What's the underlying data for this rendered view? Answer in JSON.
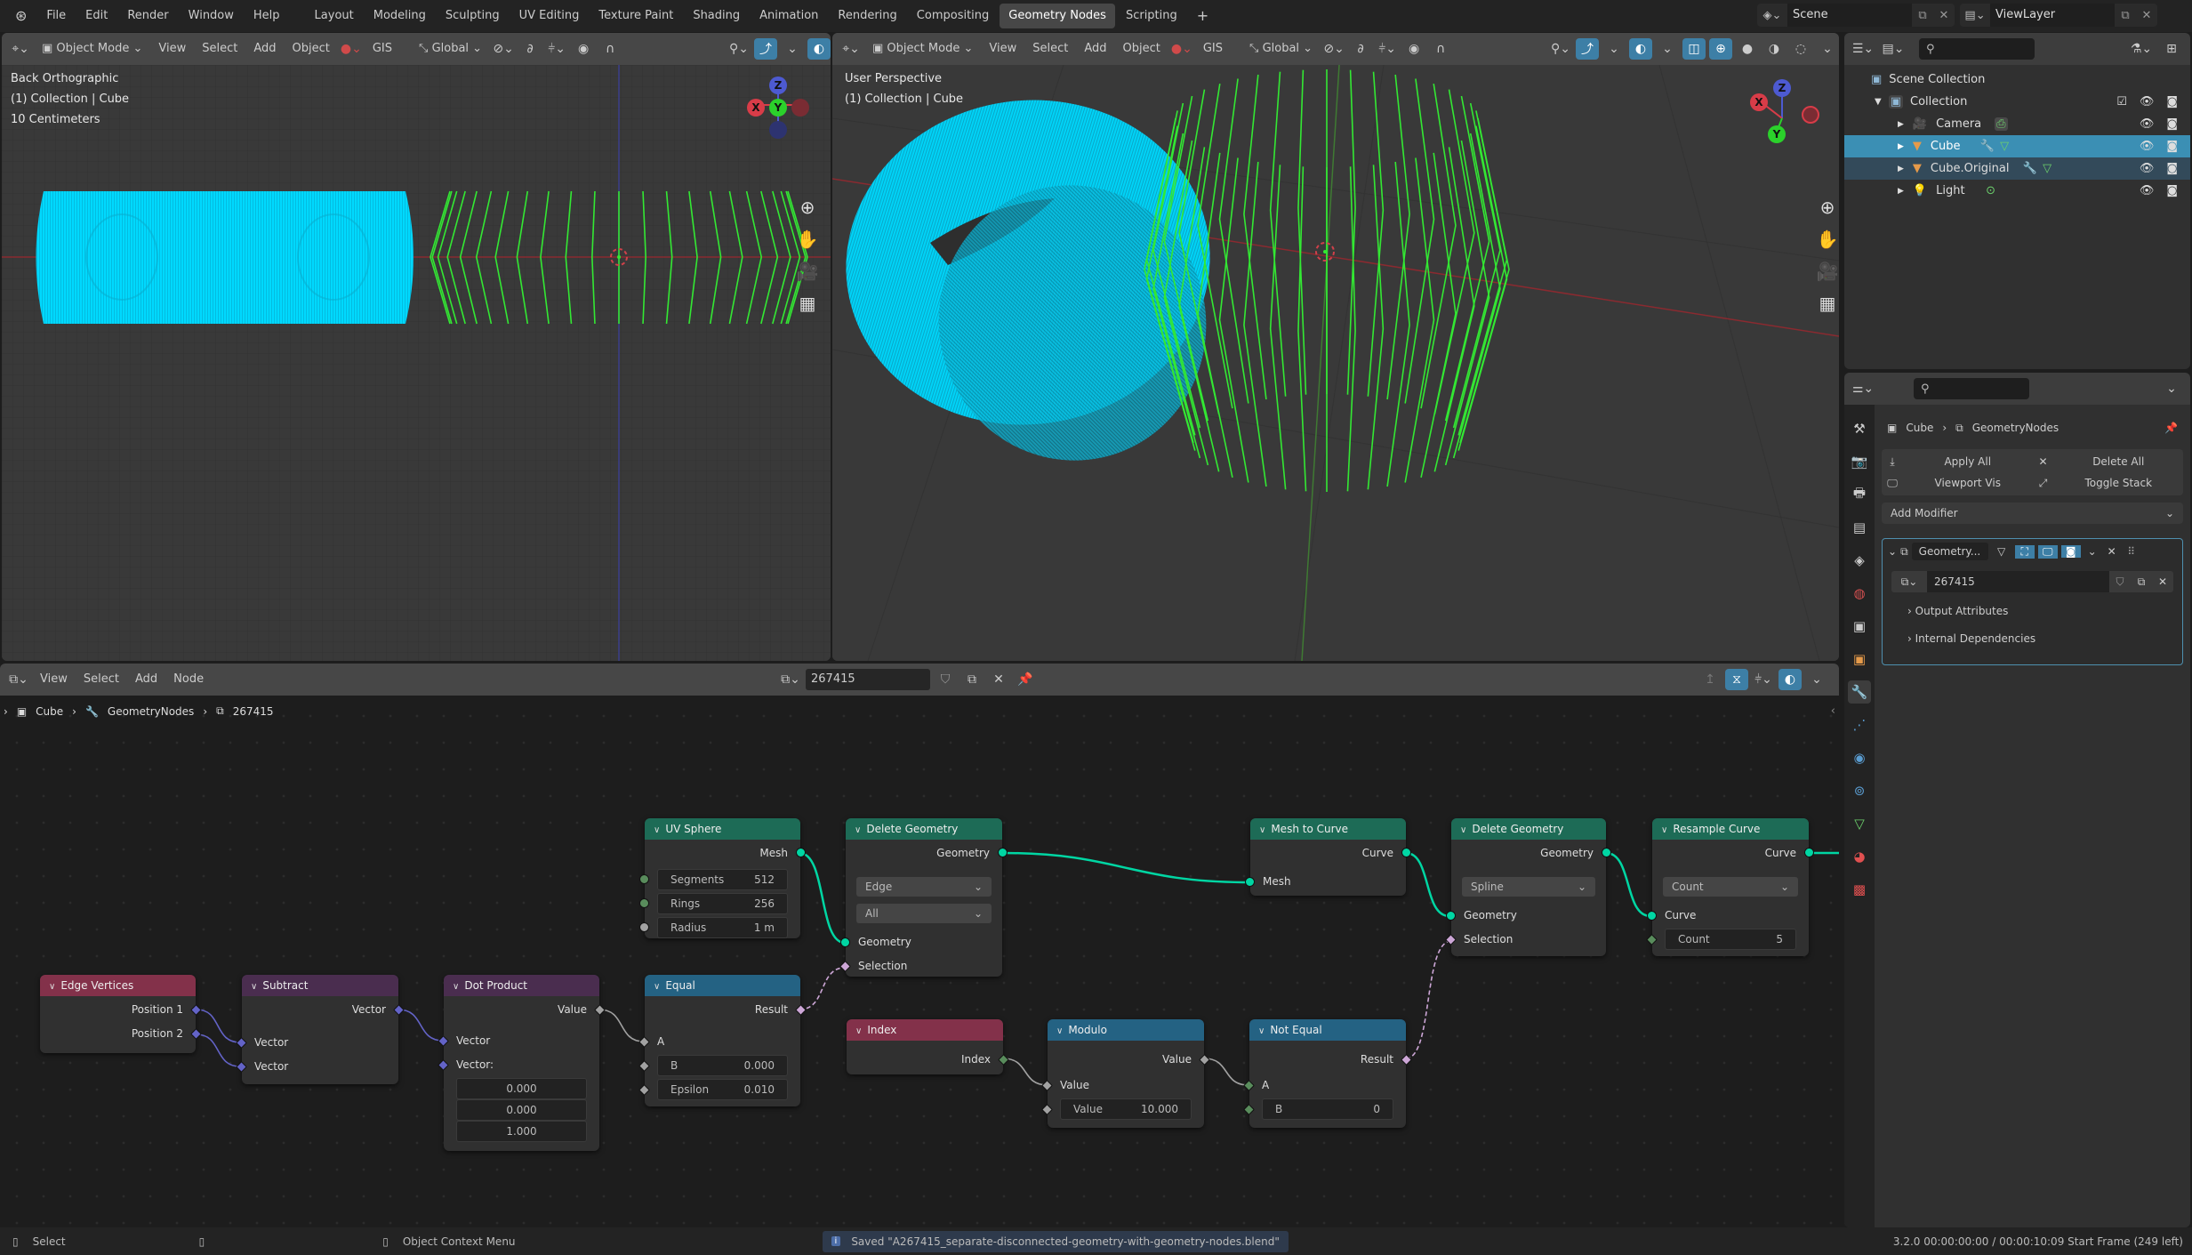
{
  "topbar": {
    "menu": [
      "File",
      "Edit",
      "Render",
      "Window",
      "Help"
    ],
    "workspaces": [
      "Layout",
      "Modeling",
      "Sculpting",
      "UV Editing",
      "Texture Paint",
      "Shading",
      "Animation",
      "Rendering",
      "Compositing",
      "Geometry Nodes",
      "Scripting"
    ],
    "active_workspace": "Geometry Nodes",
    "add_workspace": "+",
    "scene": "Scene",
    "view_layer": "ViewLayer"
  },
  "viewport_header": {
    "mode": "Object Mode",
    "menus": [
      "View",
      "Select",
      "Add",
      "Object"
    ],
    "gis": "GIS",
    "orientation": "Global"
  },
  "viewport_left": {
    "view_name": "Back Orthographic",
    "collection": "(1) Collection | Cube",
    "scale": "10 Centimeters",
    "gizmo": {
      "x": "X",
      "y": "Y",
      "z": "Z"
    }
  },
  "viewport_right": {
    "view_name": "User Perspective",
    "collection": "(1) Collection | Cube",
    "gizmo": {
      "x": "X",
      "y": "Y",
      "z": "Z"
    }
  },
  "colors": {
    "mesh_cyan": "#00d9ff",
    "curve_green": "#33e833",
    "accent_blue": "#3b8fb4",
    "x_axis": "#d83c48",
    "y_axis": "#2bd12b",
    "z_axis": "#4d5ad1"
  },
  "outliner": {
    "root": "Scene Collection",
    "collection": "Collection",
    "items": [
      {
        "name": "Camera",
        "selected": false
      },
      {
        "name": "Cube",
        "selected": true
      },
      {
        "name": "Cube.Original",
        "selected": false
      },
      {
        "name": "Light",
        "selected": false
      }
    ]
  },
  "properties": {
    "breadcrumb": {
      "object": "Cube",
      "modifier": "GeometryNodes"
    },
    "apply_all": "Apply All",
    "delete_all": "Delete All",
    "viewport_vis": "Viewport Vis",
    "toggle_stack": "Toggle Stack",
    "add_modifier": "Add Modifier",
    "modifier_name": "Geometry...",
    "node_group": "267415",
    "output_attributes": "Output Attributes",
    "internal_dependencies": "Internal Dependencies"
  },
  "node_editor": {
    "menus": [
      "View",
      "Select",
      "Add",
      "Node"
    ],
    "node_group": "267415",
    "breadcrumb": [
      "Cube",
      "GeometryNodes",
      "267415"
    ],
    "nodes": {
      "uv_sphere": {
        "title": "UV Sphere",
        "out": "Mesh",
        "segments_label": "Segments",
        "segments": "512",
        "rings_label": "Rings",
        "rings": "256",
        "radius_label": "Radius",
        "radius": "1 m"
      },
      "delete_geo_1": {
        "title": "Delete Geometry",
        "out": "Geometry",
        "domain": "Edge",
        "mode": "All",
        "in_geo": "Geometry",
        "in_sel": "Selection"
      },
      "mesh_to_curve": {
        "title": "Mesh to Curve",
        "out": "Curve",
        "in": "Mesh"
      },
      "delete_geo_2": {
        "title": "Delete Geometry",
        "out": "Geometry",
        "domain": "Spline",
        "in_geo": "Geometry",
        "in_sel": "Selection"
      },
      "resample": {
        "title": "Resample Curve",
        "out": "Curve",
        "mode": "Count",
        "in": "Curve",
        "count_label": "Count",
        "count": "5"
      },
      "edge_vertices": {
        "title": "Edge Vertices",
        "out1": "Position 1",
        "out2": "Position 2"
      },
      "subtract": {
        "title": "Subtract",
        "out": "Vector",
        "in1": "Vector",
        "in2": "Vector"
      },
      "dot_product": {
        "title": "Dot Product",
        "out": "Value",
        "in1": "Vector",
        "in2": "Vector:",
        "x": "0.000",
        "y": "0.000",
        "z": "1.000"
      },
      "equal": {
        "title": "Equal",
        "out": "Result",
        "in_a": "A",
        "b_label": "B",
        "b": "0.000",
        "eps_label": "Epsilon",
        "eps": "0.010"
      },
      "index": {
        "title": "Index",
        "out": "Index"
      },
      "modulo": {
        "title": "Modulo",
        "out": "Value",
        "in": "Value",
        "val_label": "Value",
        "val": "10.000"
      },
      "not_equal": {
        "title": "Not Equal",
        "out": "Result",
        "in_a": "A",
        "b_label": "B",
        "b": "0"
      }
    }
  },
  "statusbar": {
    "select": "Select",
    "context_menu": "Object Context Menu",
    "message": "Saved \"A267415_separate-disconnected-geometry-with-geometry-nodes.blend\"",
    "info": "3.2.0  00:00:00:00 / 00:00:10:09  Start Frame (249 left)"
  }
}
